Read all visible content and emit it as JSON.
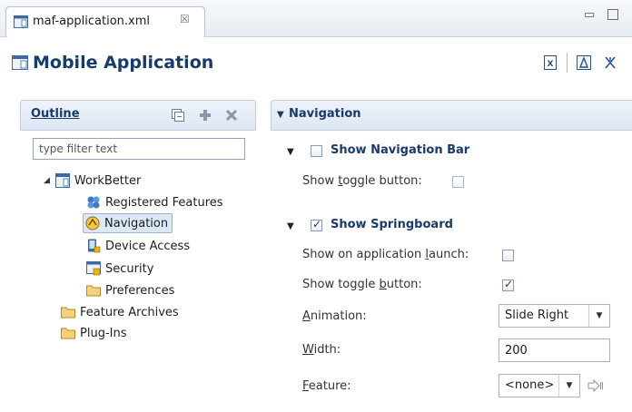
{
  "tab": {
    "label": "maf-application.xml",
    "close_glyph": "☒",
    "icon": "mobile-app-icon"
  },
  "window_controls": {
    "minimize_glyph": "▭",
    "maximize_icon": "maximize-icon"
  },
  "header": {
    "title": "Mobile Application",
    "icons": [
      "xml-source-icon",
      "preview-icon",
      "deploy-icon"
    ]
  },
  "outline": {
    "title": "Outline",
    "actions": [
      "collapse-all-icon",
      "add-icon",
      "remove-icon"
    ],
    "filter_placeholder": "type filter text",
    "tree": {
      "root": "WorkBetter",
      "children": [
        "Registered Features",
        "Navigation",
        "Device Access",
        "Security",
        "Preferences"
      ],
      "siblings": [
        "Feature Archives",
        "Plug-Ins"
      ]
    },
    "selected": "Navigation"
  },
  "navigation": {
    "title": "Navigation",
    "nav_bar": {
      "label": "Show Navigation Bar",
      "checked": false,
      "toggle_label_pre": "Show ",
      "toggle_label_u": "t",
      "toggle_label_post": "oggle button:",
      "toggle_checked": false
    },
    "springboard": {
      "label": "Show Springboard",
      "checked": true,
      "launch_pre": "Show on application ",
      "launch_u": "l",
      "launch_post": "aunch:",
      "launch_checked": false,
      "toggle_pre": "Show toggle ",
      "toggle_u": "b",
      "toggle_post": "utton:",
      "toggle_checked": true,
      "animation_u": "A",
      "animation_post": "nimation:",
      "animation_value": "Slide Right",
      "width_u": "W",
      "width_post": "idth:",
      "width_value": "200",
      "feature_u": "F",
      "feature_post": "eature:",
      "feature_value": "<none>"
    }
  }
}
